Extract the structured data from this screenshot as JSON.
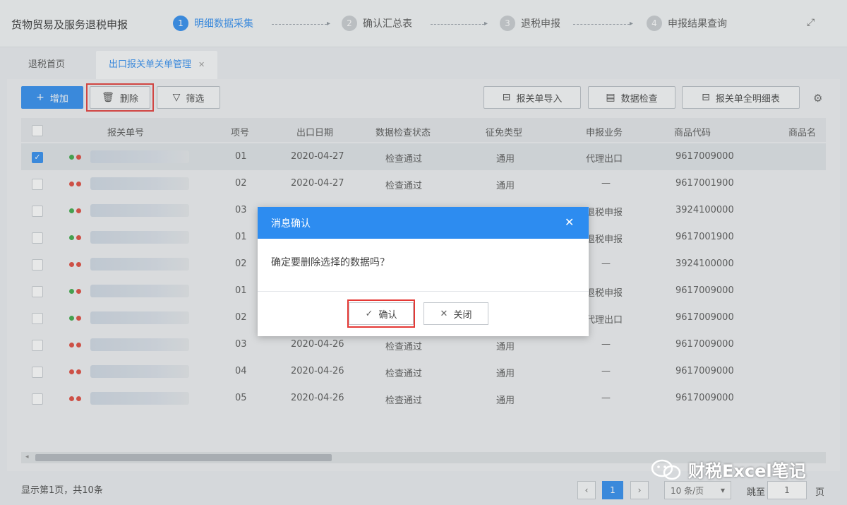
{
  "header": {
    "app_title": "货物贸易及服务退税申报",
    "steps": [
      {
        "num": "1",
        "label": "明细数据采集"
      },
      {
        "num": "2",
        "label": "确认汇总表"
      },
      {
        "num": "3",
        "label": "退税申报"
      },
      {
        "num": "4",
        "label": "申报结果查询"
      }
    ],
    "fullscreen_icon": "expand-icon"
  },
  "tabs": [
    {
      "label": "退税首页"
    },
    {
      "label": "出口报关单关单管理"
    }
  ],
  "toolbar": {
    "add_label": "增加",
    "delete_label": "删除",
    "filter_label": "筛选",
    "import_label": "报关单导入",
    "check_label": "数据检查",
    "detail_label": "报关单全明细表",
    "settings_icon": "column-settings-icon"
  },
  "table": {
    "columns": [
      "报关单号",
      "项号",
      "出口日期",
      "数据检查状态",
      "征免类型",
      "申报业务",
      "商品代码",
      "商品名"
    ],
    "rows": [
      {
        "dots": [
          "green",
          "red"
        ],
        "item": "01",
        "date": "2020-04-27",
        "status": "检查通过",
        "type": "通用",
        "business": "代理出口",
        "code": "9617009000",
        "checked": true
      },
      {
        "dots": [
          "red",
          "red"
        ],
        "item": "02",
        "date": "2020-04-27",
        "status": "检查通过",
        "type": "通用",
        "business": "—",
        "code": "9617001900",
        "checked": false
      },
      {
        "dots": [
          "green",
          "red"
        ],
        "item": "03",
        "date": "",
        "status": "",
        "type": "",
        "business": "退税申报",
        "code": "3924100000",
        "checked": false
      },
      {
        "dots": [
          "green",
          "red"
        ],
        "item": "01",
        "date": "",
        "status": "",
        "type": "",
        "business": "退税申报",
        "code": "9617001900",
        "checked": false
      },
      {
        "dots": [
          "red",
          "red"
        ],
        "item": "02",
        "date": "",
        "status": "",
        "type": "",
        "business": "—",
        "code": "3924100000",
        "checked": false
      },
      {
        "dots": [
          "green",
          "red"
        ],
        "item": "01",
        "date": "",
        "status": "",
        "type": "",
        "business": "退税申报",
        "code": "9617009000",
        "checked": false
      },
      {
        "dots": [
          "green",
          "red"
        ],
        "item": "02",
        "date": "",
        "status": "",
        "type": "",
        "business": "代理出口",
        "code": "9617009000",
        "checked": false
      },
      {
        "dots": [
          "red",
          "red"
        ],
        "item": "03",
        "date": "2020-04-26",
        "status": "检查通过",
        "type": "通用",
        "business": "—",
        "code": "9617009000",
        "checked": false
      },
      {
        "dots": [
          "red",
          "red"
        ],
        "item": "04",
        "date": "2020-04-26",
        "status": "检查通过",
        "type": "通用",
        "business": "—",
        "code": "9617009000",
        "checked": false
      },
      {
        "dots": [
          "red",
          "red"
        ],
        "item": "05",
        "date": "2020-04-26",
        "status": "检查通过",
        "type": "通用",
        "business": "—",
        "code": "9617009000",
        "checked": false
      }
    ]
  },
  "footer": {
    "summary": "显示第1页，共10条",
    "current_page": "1",
    "page_size": "10 条/页",
    "goto_label": "跳至",
    "goto_value": "1",
    "page_suffix": "页"
  },
  "dialog": {
    "title": "消息确认",
    "message": "确定要删除选择的数据吗？",
    "confirm_label": "确认",
    "close_label": "关闭"
  },
  "watermark": "财税Excel笔记",
  "colors": {
    "accent": "#2d8cf0",
    "highlight": "#e53935",
    "dot_green": "#3aa845",
    "dot_red": "#e0463a"
  }
}
